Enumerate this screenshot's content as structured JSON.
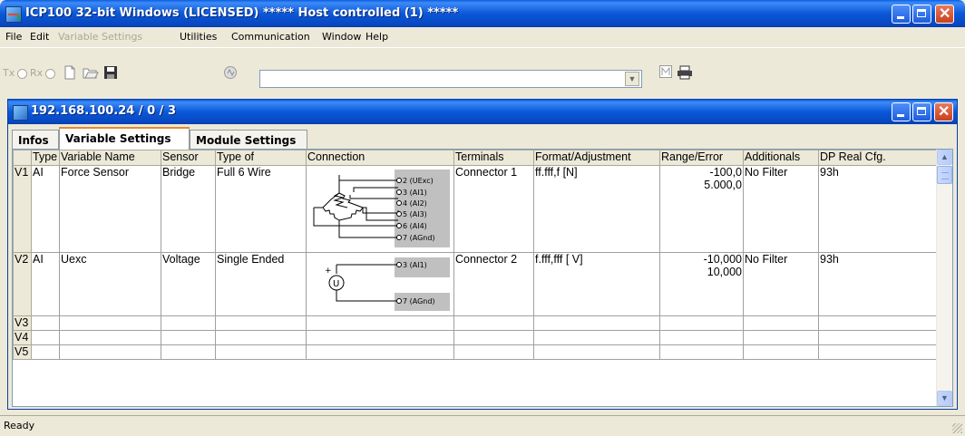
{
  "window": {
    "title": "ICP100 32-bit Windows  (LICENSED)  *****  Host controlled (1)  *****"
  },
  "menu": {
    "items": [
      "File",
      "Edit",
      "Variable Settings",
      "Utilities",
      "Communication",
      "Window",
      "Help"
    ],
    "disabled": [
      "Variable Settings"
    ]
  },
  "toolbar": {
    "tx_label": "Tx",
    "rx_label": "Rx",
    "icons": [
      "new-file-icon",
      "open-folder-icon",
      "save-disk-icon",
      "connect-icon",
      "m-icon",
      "print-icon"
    ],
    "address_value": ""
  },
  "child": {
    "title": "192.168.100.24  / 0 / 3",
    "tabs": [
      "Infos",
      "Variable Settings",
      "Module Settings"
    ],
    "active_tab": "Variable Settings"
  },
  "grid": {
    "columns": [
      "",
      "Type",
      "Variable Name",
      "Sensor",
      "Type of",
      "Connection",
      "Terminals",
      "Format/Adjustment",
      "Range/Error",
      "Additionals",
      "DP Real Cfg."
    ],
    "rows": [
      {
        "id": "V1",
        "type": "AI",
        "name": "Force Sensor",
        "sensor": "Bridge",
        "type_of": "Full 6 Wire",
        "terminals": "Connector 1",
        "format": "ff.fff,f [N]",
        "range_min": "-100,0",
        "range_max": "5.000,0",
        "additionals": "No Filter",
        "dp": "93h",
        "pins": [
          "2 (UExc)",
          "3 (AI1)",
          "4 (AI2)",
          "5 (AI3)",
          "6 (AI4)",
          "7 (AGnd)"
        ]
      },
      {
        "id": "V2",
        "type": "AI",
        "name": "Uexc",
        "sensor": "Voltage",
        "type_of": "Single Ended",
        "terminals": "Connector 2",
        "format": "f.fff,fff [ V]",
        "range_min": "-10,000",
        "range_max": "10,000",
        "additionals": "No Filter",
        "dp": "93h",
        "pins": [
          "3 (AI1)",
          "7 (AGnd)"
        ],
        "source_symbol": "U",
        "source_polarity": "+"
      },
      {
        "id": "V3"
      },
      {
        "id": "V4"
      },
      {
        "id": "V5"
      }
    ]
  },
  "status": {
    "text": "Ready"
  },
  "colors": {
    "title_blue": "#0a58d8",
    "tab_accent": "#e68b2c",
    "connector_gray": "#c0c0c0"
  }
}
